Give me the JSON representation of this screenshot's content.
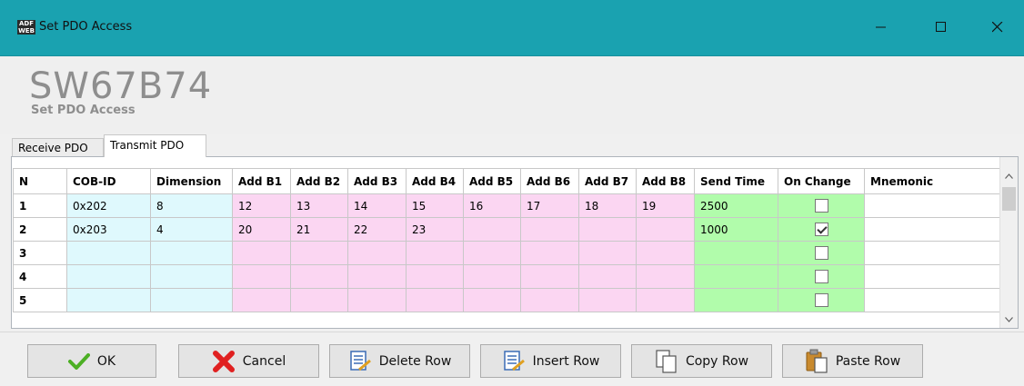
{
  "window": {
    "title": "Set PDO Access",
    "icon_text_top": "ADF",
    "icon_text_bottom": "WEB"
  },
  "header": {
    "brand": "SW67B74",
    "subtitle": "Set PDO Access"
  },
  "tabs": [
    {
      "label": "Receive PDO",
      "active": false
    },
    {
      "label": "Transmit PDO",
      "active": true
    }
  ],
  "table": {
    "columns": [
      "N",
      "COB-ID",
      "Dimension",
      "Add B1",
      "Add B2",
      "Add B3",
      "Add B4",
      "Add B5",
      "Add B6",
      "Add B7",
      "Add B8",
      "Send Time",
      "On Change",
      "Mnemonic"
    ],
    "rows": [
      {
        "n": "1",
        "cob_id": "0x202",
        "dimension": "8",
        "b": [
          "12",
          "13",
          "14",
          "15",
          "16",
          "17",
          "18",
          "19"
        ],
        "send_time": "2500",
        "on_change": false,
        "mnemonic": ""
      },
      {
        "n": "2",
        "cob_id": "0x203",
        "dimension": "4",
        "b": [
          "20",
          "21",
          "22",
          "23",
          "",
          "",
          "",
          ""
        ],
        "send_time": "1000",
        "on_change": true,
        "mnemonic": ""
      },
      {
        "n": "3",
        "cob_id": "",
        "dimension": "",
        "b": [
          "",
          "",
          "",
          "",
          "",
          "",
          "",
          ""
        ],
        "send_time": "",
        "on_change": false,
        "mnemonic": ""
      },
      {
        "n": "4",
        "cob_id": "",
        "dimension": "",
        "b": [
          "",
          "",
          "",
          "",
          "",
          "",
          "",
          ""
        ],
        "send_time": "",
        "on_change": false,
        "mnemonic": ""
      },
      {
        "n": "5",
        "cob_id": "",
        "dimension": "",
        "b": [
          "",
          "",
          "",
          "",
          "",
          "",
          "",
          ""
        ],
        "send_time": "",
        "on_change": false,
        "mnemonic": ""
      }
    ]
  },
  "buttons": {
    "ok": "OK",
    "cancel": "Cancel",
    "delete_row": "Delete Row",
    "insert_row": "Insert Row",
    "copy_row": "Copy Row",
    "paste_row": "Paste Row"
  },
  "colors": {
    "titlebar": "#1aa2b0",
    "blue_cells": "#dff9fd",
    "pink_cells": "#fbd6f2",
    "green_cells": "#b1fcab"
  }
}
